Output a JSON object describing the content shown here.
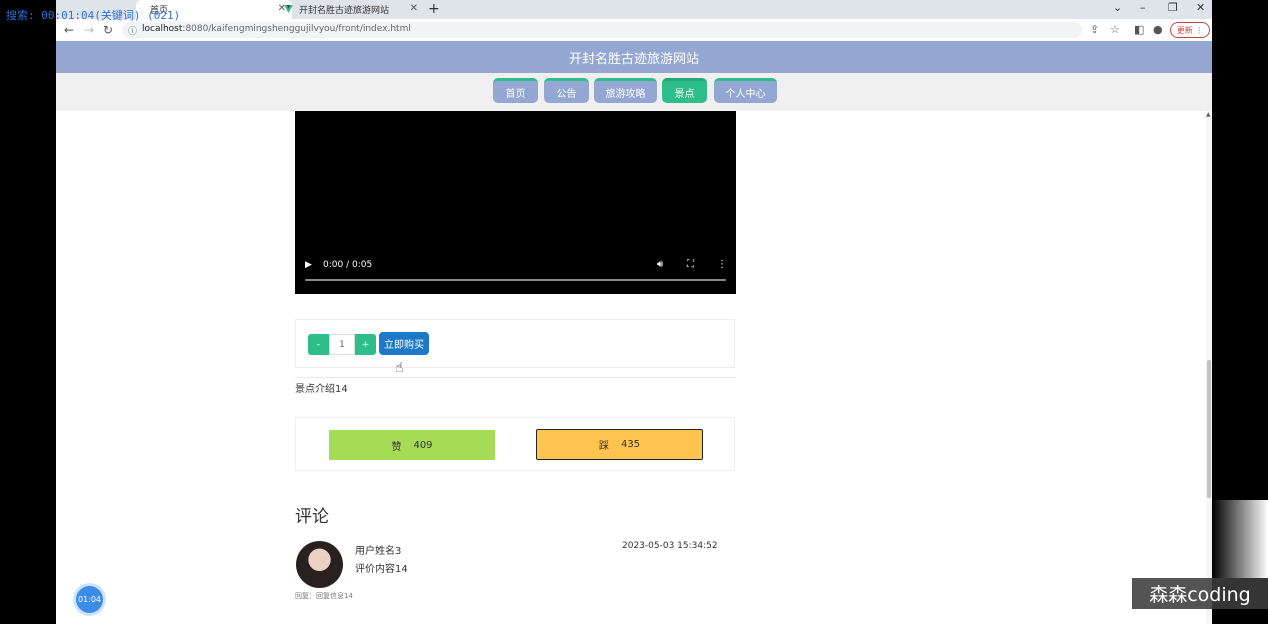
{
  "recorder": {
    "overlay_text": "搜索: 00:01:04(关键词) (021)"
  },
  "browser": {
    "tabs": [
      {
        "label": "首页",
        "active": true
      },
      {
        "label": "开封名胜古迹旅游网站",
        "active": false
      }
    ],
    "url_host": "localhost",
    "url_rest": ":8080/kaifengmingshenggujilvyou/front/index.html",
    "update_label": "更新"
  },
  "site": {
    "title": "开封名胜古迹旅游网站",
    "nav": [
      {
        "label": "首页",
        "active": false
      },
      {
        "label": "公告",
        "active": false
      },
      {
        "label": "旅游攻略",
        "active": false
      },
      {
        "label": "景点",
        "active": true
      },
      {
        "label": "个人中心",
        "active": false
      }
    ]
  },
  "video": {
    "time": "0:00 / 0:05"
  },
  "purchase": {
    "minus": "-",
    "quantity": "1",
    "plus": "+",
    "buy_label": "立即购买"
  },
  "intro": "景点介绍14",
  "votes": {
    "like_label": "赞",
    "like_count": "409",
    "dislike_label": "踩",
    "dislike_count": "435"
  },
  "comments": {
    "title": "评论",
    "items": [
      {
        "user": "用户姓名3",
        "text": "评价内容14",
        "date": "2023-05-03 15:34:52",
        "reply": "回复：回复信息14"
      }
    ]
  },
  "timer": "01:04",
  "watermark": "森森coding"
}
